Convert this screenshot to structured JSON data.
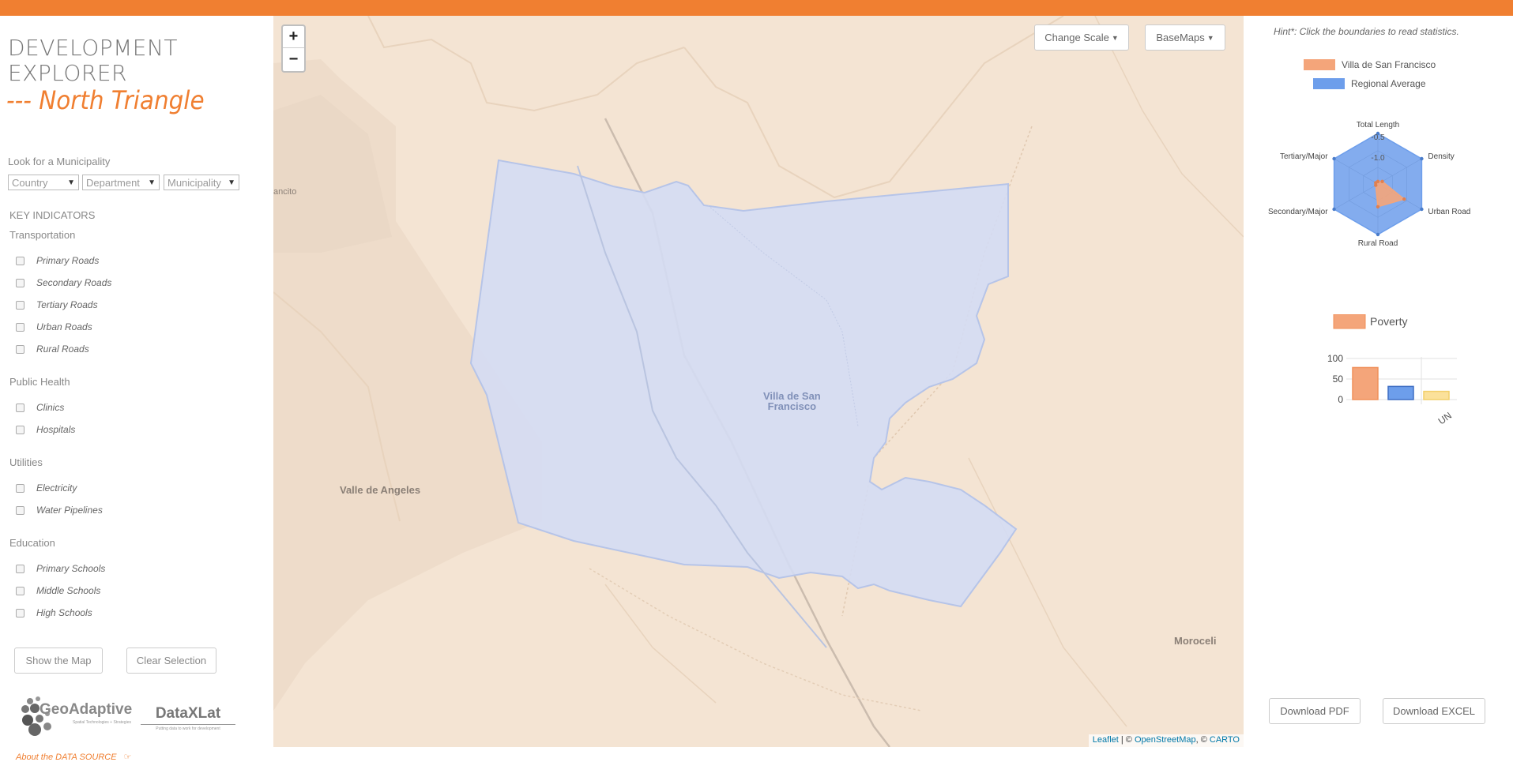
{
  "app": {
    "title_line1": "DEVELOPMENT",
    "title_line2": "EXPLORER",
    "subtitle": "--- North Triangle"
  },
  "search": {
    "label": "Look for a Municipality",
    "country": "Country",
    "department": "Department",
    "municipality": "Municipality"
  },
  "indicators": {
    "heading": "KEY INDICATORS",
    "transportation": "Transportation",
    "transport_items": [
      "Primary Roads",
      "Secondary Roads",
      "Tertiary Roads",
      "Urban Roads",
      "Rural Roads"
    ],
    "public_health": "Public Health",
    "health_items": [
      "Clinics",
      "Hospitals"
    ],
    "utilities": "Utilities",
    "utility_items": [
      "Electricity",
      "Water Pipelines"
    ],
    "education": "Education",
    "education_items": [
      "Primary Schools",
      "Middle Schools",
      "High Schools"
    ]
  },
  "actions": {
    "show_map": "Show the Map",
    "clear": "Clear Selection"
  },
  "logos": {
    "geo": "GeoAdaptive",
    "geo_tag": "Spatial Technologies + Strategies",
    "dataxlat": "DataXLat",
    "dataxlat_tag": "Putting data to work for development"
  },
  "about": "About the DATA SOURCE",
  "map": {
    "zoom_in": "+",
    "zoom_out": "−",
    "change_scale": "Change Scale",
    "basemaps": "BaseMaps",
    "places": {
      "villa": "Villa de San Francisco",
      "villa_l1": "Villa de San",
      "villa_l2": "Francisco",
      "valle": "Valle de Angeles",
      "moroceli": "Moroceli",
      "ancito": "ancito"
    },
    "attribution_leaflet": "Leaflet",
    "attribution_sep1": " | © ",
    "attribution_osm": "OpenStreetMap",
    "attribution_sep2": ", © ",
    "attribution_carto": "CARTO"
  },
  "right": {
    "hint": "Hint*: Click the boundaries to read statistics.",
    "legend_selected": "Villa de San Francisco",
    "legend_regional": "Regional Average",
    "download_pdf": "Download PDF",
    "download_excel": "Download EXCEL"
  },
  "colors": {
    "accent": "#f07f31",
    "selected": "#f4a57a",
    "regional": "#6d9eeb",
    "map_bg": "#f4e4d3",
    "polygon": "#d4dcf4"
  },
  "chart_data": [
    {
      "type": "radar",
      "axes": [
        "Total Length",
        "Density",
        "Urban Road",
        "Rural Road",
        "Secondary/Major",
        "Tertiary/Major"
      ],
      "tick_labels": [
        "-0.5",
        "-1.0"
      ],
      "series": [
        {
          "name": "Villa de San Francisco",
          "values": [
            0.05,
            0.1,
            0.6,
            0.45,
            0.05,
            0.05
          ]
        },
        {
          "name": "Regional Average",
          "values": [
            1,
            1,
            1,
            1,
            1,
            1
          ]
        }
      ]
    },
    {
      "type": "bar",
      "legend": "Poverty",
      "categories": [
        "",
        "",
        "UN"
      ],
      "values": [
        78,
        32,
        20
      ],
      "colors": [
        "#f4a57a",
        "#6d9eeb",
        "#fbe19a"
      ],
      "y_ticks": [
        "100",
        "50",
        "0"
      ],
      "ylim": [
        0,
        100
      ]
    }
  ]
}
